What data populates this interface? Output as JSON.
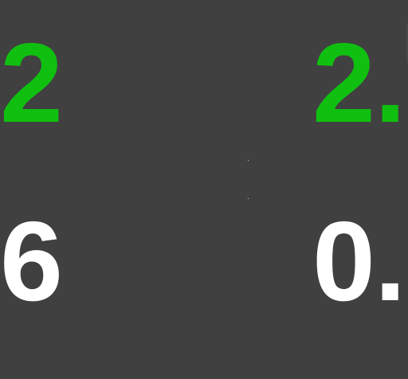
{
  "display": {
    "top_left_value": "2",
    "top_right_value": "2.",
    "bottom_left_value": "6",
    "bottom_right_value": "0."
  },
  "colors": {
    "background": "#404040",
    "top_row_text": "#10c010",
    "bottom_row_text": "#ffffff"
  }
}
